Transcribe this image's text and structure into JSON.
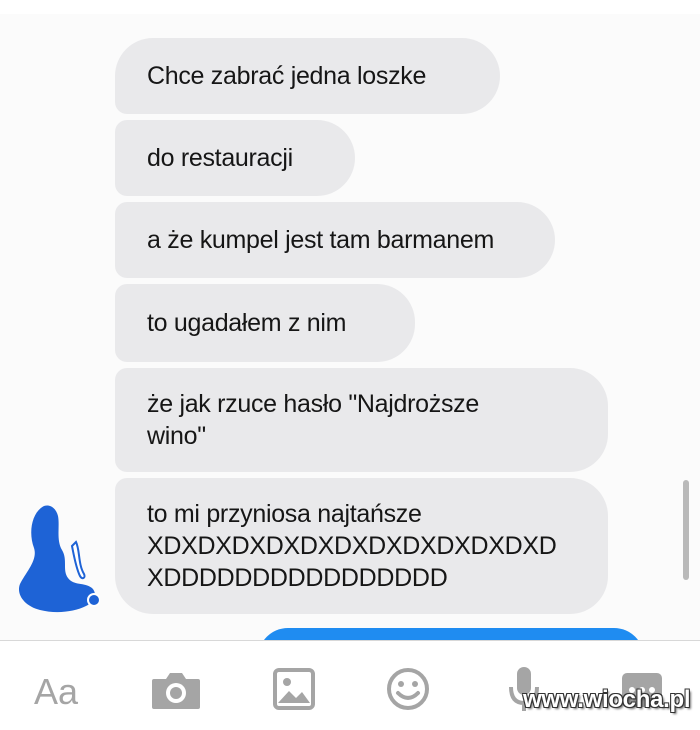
{
  "messages": [
    {
      "text": "Chce zabrać jedna loszke"
    },
    {
      "text": "do restauracji"
    },
    {
      "text": "a że kumpel jest tam barmanem"
    },
    {
      "text": "to ugadałem z nim"
    },
    {
      "text": "że jak rzuce hasło  \"Najdroższe\nwino\""
    },
    {
      "text": "to mi przyniosa najtańsze\nXDXDXDXDXDXDXDXDXDXDXDXD\nXDDDDDDDDDDDDDDDD"
    }
  ],
  "composer": {
    "text_button_label": "Aa",
    "icons": [
      "camera-icon",
      "image-icon",
      "emoji-icon",
      "microphone-icon",
      "more-icon"
    ]
  },
  "watermark": {
    "text": "www.wiocha.pl"
  },
  "colors": {
    "received_bubble": "#e9e9eb",
    "sent_bubble": "#1f8cf1",
    "icon_gray": "#a5a5a5",
    "avatar_blue": "#1e63d6"
  }
}
